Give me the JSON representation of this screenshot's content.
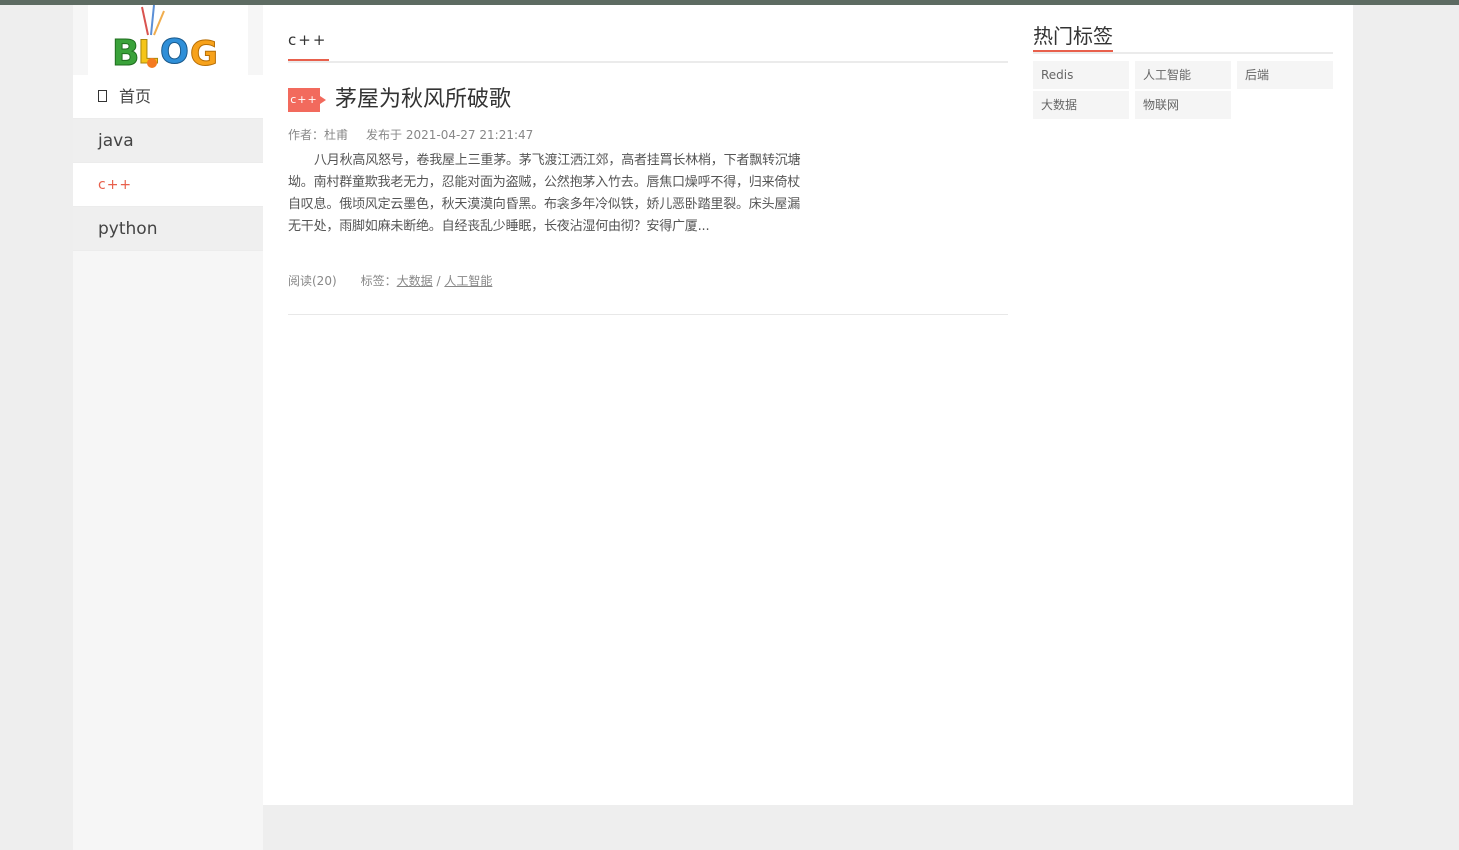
{
  "logo": {
    "text": "BLOG"
  },
  "nav": {
    "home_icon": "home-icon",
    "items": [
      {
        "label": "首页"
      },
      {
        "label": "java"
      },
      {
        "label": "c++"
      },
      {
        "label": "python"
      }
    ],
    "active_color": "#e8604c"
  },
  "category": {
    "title": "c++"
  },
  "article": {
    "badge": "c++",
    "title": "茅屋为秋风所破歌",
    "author": "作者：杜甫",
    "published": "发布于 2021-04-27 21:21:47",
    "excerpt": "八月秋高风怒号，卷我屋上三重茅。茅飞渡江洒江郊，高者挂罥长林梢，下者飘转沉塘坳。南村群童欺我老无力，忍能对面为盗贼，公然抱茅入竹去。唇焦口燥呼不得，归来倚杖自叹息。俄顷风定云墨色，秋天漠漠向昏黑。布衾多年冷似铁，娇儿恶卧踏里裂。床头屋漏无干处，雨脚如麻未断绝。自经丧乱少睡眠，长夜沾湿何由彻？安得广厦...",
    "reads": "阅读(20)",
    "tags_label": "标签：",
    "tags": [
      "大数据",
      "人工智能"
    ],
    "tag_separator": " / "
  },
  "sidebar_right": {
    "title": "热门标签",
    "tags": [
      "Redis",
      "人工智能",
      "后端",
      "大数据",
      "物联网"
    ]
  },
  "colors": {
    "accent": "#e8604c",
    "badge": "#f26a5d",
    "topbar": "#5d6b62"
  }
}
